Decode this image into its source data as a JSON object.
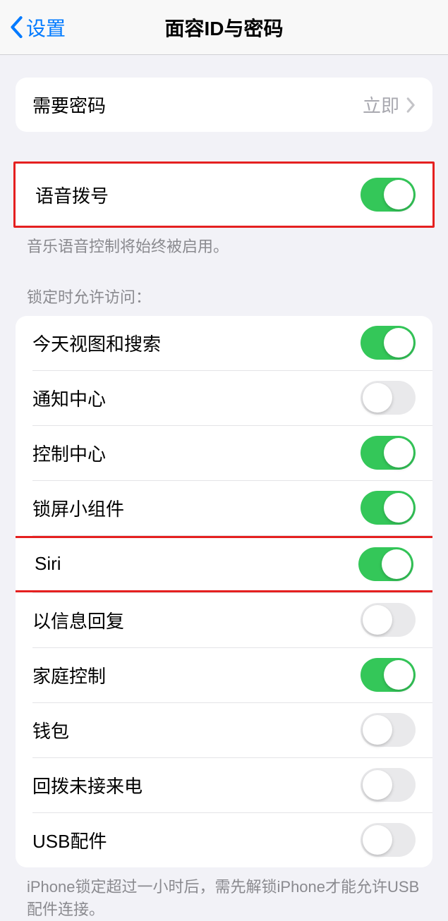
{
  "header": {
    "back_label": "设置",
    "title": "面容ID与密码"
  },
  "passcode_group": {
    "require_passcode_label": "需要密码",
    "require_passcode_value": "立即"
  },
  "voice_dial": {
    "label": "语音拨号",
    "on": true,
    "footer": "音乐语音控制将始终被启用。"
  },
  "lock_access": {
    "header": "锁定时允许访问：",
    "items": [
      {
        "label": "今天视图和搜索",
        "on": true
      },
      {
        "label": "通知中心",
        "on": false
      },
      {
        "label": "控制中心",
        "on": true
      },
      {
        "label": "锁屏小组件",
        "on": true
      },
      {
        "label": "Siri",
        "on": true
      },
      {
        "label": "以信息回复",
        "on": false
      },
      {
        "label": "家庭控制",
        "on": true
      },
      {
        "label": "钱包",
        "on": false
      },
      {
        "label": "回拨未接来电",
        "on": false
      },
      {
        "label": "USB配件",
        "on": false
      }
    ],
    "footer": "iPhone锁定超过一小时后，需先解锁iPhone才能允许USB配件连接。"
  }
}
